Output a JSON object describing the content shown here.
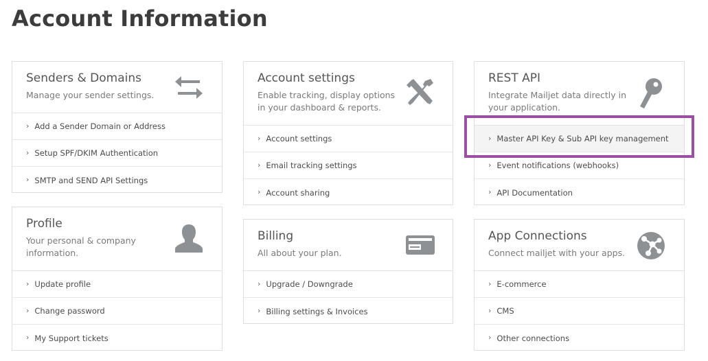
{
  "page": {
    "title": "Account Information"
  },
  "cards": {
    "senders": {
      "title": "Senders & Domains",
      "description": "Manage your sender settings.",
      "icon": "swap-arrows-icon",
      "items": [
        "Add a Sender Domain or Address",
        "Setup SPF/DKIM Authentication",
        "SMTP and SEND API Settings"
      ]
    },
    "profile": {
      "title": "Profile",
      "description": "Your personal & company information.",
      "icon": "user-icon",
      "items": [
        "Update profile",
        "Change password",
        "My Support tickets"
      ]
    },
    "account_settings": {
      "title": "Account settings",
      "description": "Enable tracking, display options in your dashboard & reports.",
      "icon": "tools-icon",
      "items": [
        "Account settings",
        "Email tracking settings",
        "Account sharing"
      ]
    },
    "billing": {
      "title": "Billing",
      "description": "All about your plan.",
      "icon": "credit-card-icon",
      "items": [
        "Upgrade / Downgrade",
        "Billing settings & Invoices"
      ]
    },
    "rest_api": {
      "title": "REST API",
      "description": "Integrate Mailjet data directly in your application.",
      "icon": "key-icon",
      "items": [
        "Master API Key & Sub API key management",
        "Event notifications (webhooks)",
        "API Documentation"
      ]
    },
    "app_connections": {
      "title": "App Connections",
      "description": "Connect mailjet with your apps.",
      "icon": "network-globe-icon",
      "items": [
        "E-commerce",
        "CMS",
        "Other connections"
      ]
    }
  },
  "annotation": {
    "highlight_color": "#9b4fa4"
  }
}
